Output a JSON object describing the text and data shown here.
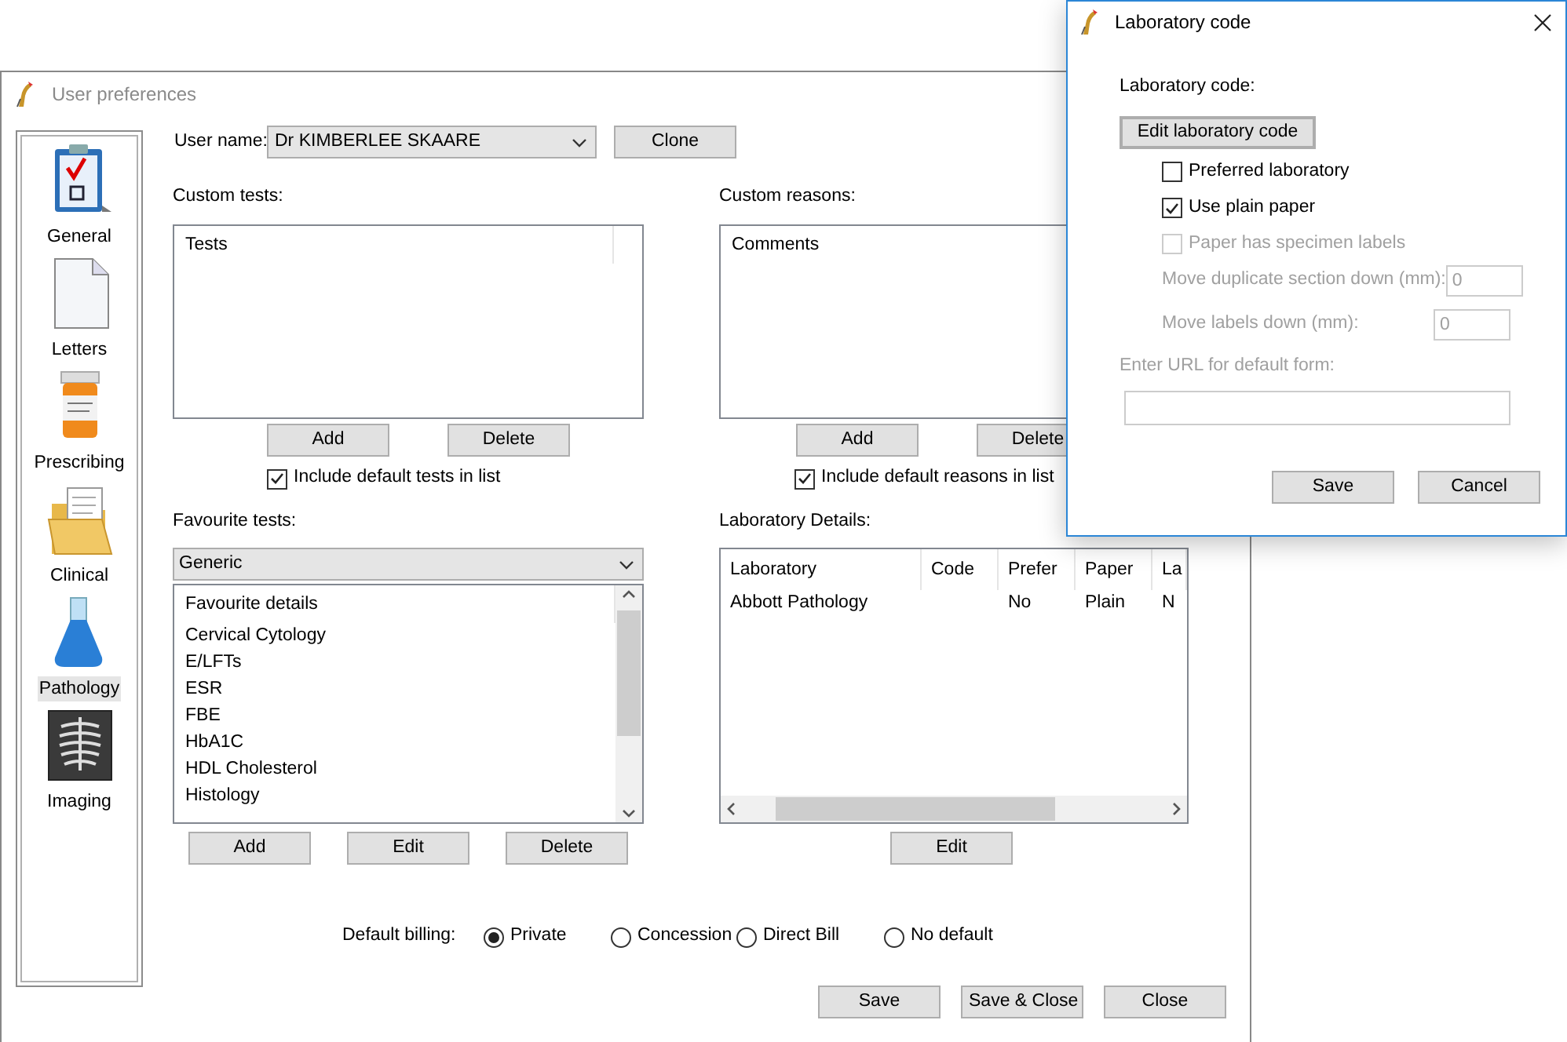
{
  "main_window": {
    "title": "User preferences",
    "active": false
  },
  "sidebar": {
    "items": [
      {
        "label": "General",
        "selected": false
      },
      {
        "label": "Letters",
        "selected": false
      },
      {
        "label": "Prescribing",
        "selected": false
      },
      {
        "label": "Clinical",
        "selected": false
      },
      {
        "label": "Pathology",
        "selected": true
      },
      {
        "label": "Imaging",
        "selected": false
      }
    ]
  },
  "user_name": {
    "label": "User name:",
    "value": "Dr KIMBERLEE SKAARE"
  },
  "clone_button": "Clone",
  "custom_tests": {
    "label": "Custom tests:",
    "column": "Tests",
    "buttons": [
      "Add",
      "Delete"
    ],
    "include_default": {
      "label": "Include default tests in list",
      "checked": true
    }
  },
  "custom_reasons": {
    "label": "Custom reasons:",
    "column": "Comments",
    "buttons": [
      "Add",
      "Delete"
    ],
    "include_default": {
      "label": "Include default reasons in list",
      "checked": true
    }
  },
  "favourite_tests": {
    "label": "Favourite tests:",
    "group": "Generic",
    "column": "Favourite details",
    "items": [
      "Cervical Cytology",
      "E/LFTs",
      "ESR",
      "FBE",
      "HbA1C",
      "HDL Cholesterol",
      "Histology"
    ],
    "buttons": [
      "Add",
      "Edit",
      "Delete"
    ]
  },
  "laboratory_details": {
    "label": "Laboratory Details:",
    "columns": [
      "Laboratory",
      "Code",
      "Prefer",
      "Paper",
      "La"
    ],
    "rows": [
      {
        "cells": [
          "Abbott Pathology",
          null,
          "No",
          "Plain",
          "N"
        ]
      }
    ],
    "buttons": [
      "Edit"
    ]
  },
  "default_billing": {
    "label": "Default billing:",
    "options": [
      {
        "label": "Private",
        "selected": true
      },
      {
        "label": "Concession",
        "selected": false
      },
      {
        "label": "Direct Bill",
        "selected": false
      },
      {
        "label": "No default",
        "selected": false
      }
    ]
  },
  "footer_buttons": [
    "Save",
    "Save & Close",
    "Close"
  ],
  "dialog": {
    "title": "Laboratory code",
    "section_label": "Laboratory code:",
    "edit_button": "Edit laboratory code",
    "options": [
      {
        "label": "Preferred laboratory",
        "checked": false,
        "disabled": false
      },
      {
        "label": "Use plain paper",
        "checked": true,
        "disabled": false
      },
      {
        "label": "Paper has specimen labels",
        "checked": false,
        "disabled": true
      }
    ],
    "fields": [
      {
        "label": "Move duplicate section down (mm):",
        "value": "0",
        "disabled": true
      },
      {
        "label": "Move labels down (mm):",
        "value": "0",
        "disabled": true
      }
    ],
    "url": {
      "label": "Enter URL for default form:",
      "disabled": true
    },
    "buttons": [
      "Save",
      "Cancel"
    ]
  }
}
